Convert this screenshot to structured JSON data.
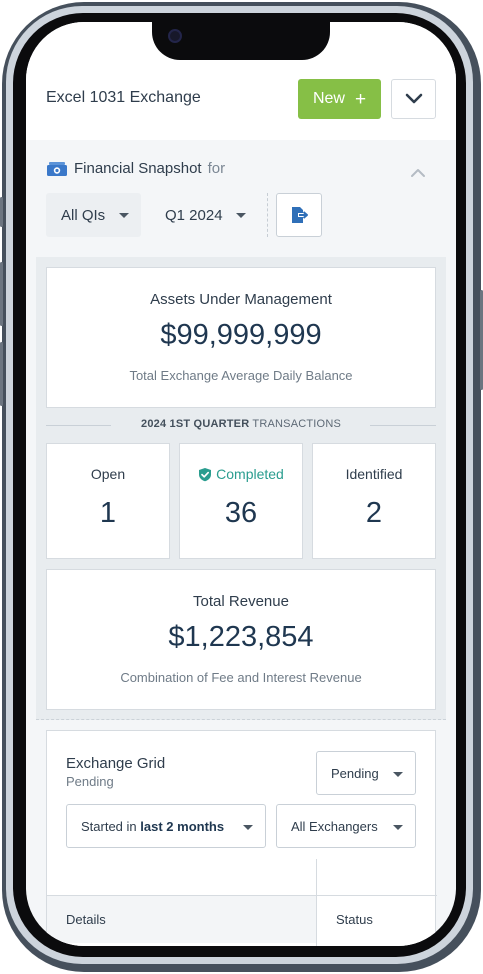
{
  "header": {
    "title": "Excel 1031 Exchange",
    "new_label": "New",
    "new_icon": "plus-icon",
    "menu_icon": "chevron-down-icon"
  },
  "snapshot": {
    "title": "Financial Snapshot",
    "for_label": "for",
    "icon": "money-icon",
    "qi_filter": "All QIs",
    "quarter_filter": "Q1 2024",
    "export_icon": "export-icon",
    "collapse_icon": "chevron-up-icon"
  },
  "aum": {
    "label": "Assets Under Management",
    "value": "$99,999,999",
    "sub": "Total Exchange Average Daily Balance"
  },
  "transactions": {
    "heading_bold": "2024 1ST QUARTER",
    "heading_rest": "TRANSACTIONS",
    "stats": [
      {
        "label": "Open",
        "value": "1"
      },
      {
        "label": "Completed",
        "value": "36",
        "icon": "shield-check-icon"
      },
      {
        "label": "Identified",
        "value": "2"
      }
    ]
  },
  "revenue": {
    "label": "Total Revenue",
    "value": "$1,223,854",
    "sub": "Combination of Fee and Interest Revenue"
  },
  "exchange_grid": {
    "title": "Exchange Grid",
    "subtitle": "Pending",
    "status_filter": "Pending",
    "date_filter_prefix": "Started in",
    "date_filter_bold": "last 2 months",
    "exchanger_filter": "All Exchangers",
    "columns": [
      "Details",
      "Status"
    ]
  },
  "colors": {
    "accent_green": "#86bf46",
    "completed_teal": "#2a9d8f",
    "value_navy": "#1f3750"
  }
}
